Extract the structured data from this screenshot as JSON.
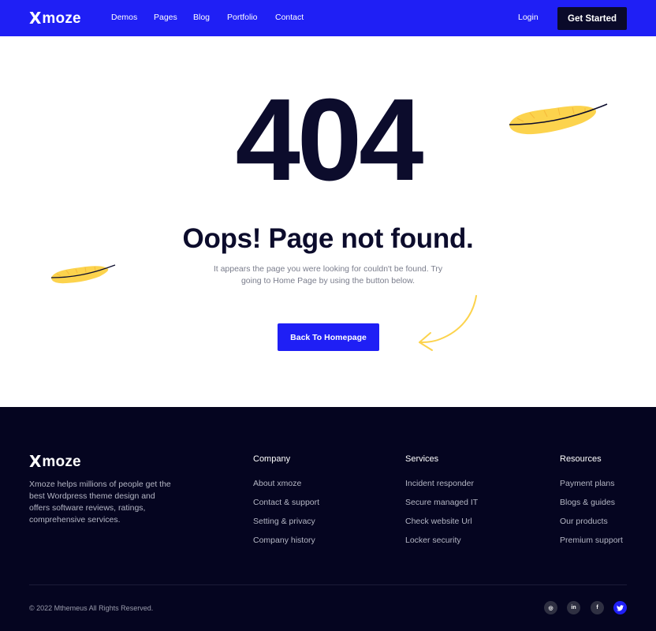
{
  "header": {
    "logo_mark": "X",
    "logo_text": "moze",
    "nav": [
      "Demos",
      "Pages",
      "Blog",
      "Portfolio",
      "Contact"
    ],
    "login": "Login",
    "cta": "Get Started"
  },
  "main": {
    "code": "404",
    "title": "Oops! Page not found.",
    "description": "It appears the page you were looking for couldn't be found. Try going to Home Page by using the button below.",
    "button": "Back To Homepage"
  },
  "footer": {
    "logo_mark": "X",
    "logo_text": "moze",
    "description": "Xmoze helps millions of people get the best Wordpress theme design and offers software reviews, ratings, comprehensive services.",
    "columns": [
      {
        "title": "Company",
        "links": [
          "About xmoze",
          "Contact & support",
          "Setting & privacy",
          "Company history"
        ]
      },
      {
        "title": "Services",
        "links": [
          "Incident responder",
          "Secure managed IT",
          "Check website Url",
          "Locker security"
        ]
      },
      {
        "title": "Resources",
        "links": [
          "Payment plans",
          "Blogs & guides",
          "Our products",
          "Premium support"
        ]
      }
    ],
    "copyright": "© 2022 Mthemeus All Rights Reserved.",
    "social": [
      {
        "name": "instagram-icon",
        "glyph": "◎"
      },
      {
        "name": "linkedin-icon",
        "glyph": "in"
      },
      {
        "name": "facebook-icon",
        "glyph": "f"
      },
      {
        "name": "twitter-icon",
        "glyph": "🐦"
      }
    ]
  },
  "colors": {
    "brand_blue": "#1f1ff5",
    "dark_navy": "#0c0c2c",
    "footer_bg": "#050520",
    "feather_yellow": "#fcd34d"
  }
}
